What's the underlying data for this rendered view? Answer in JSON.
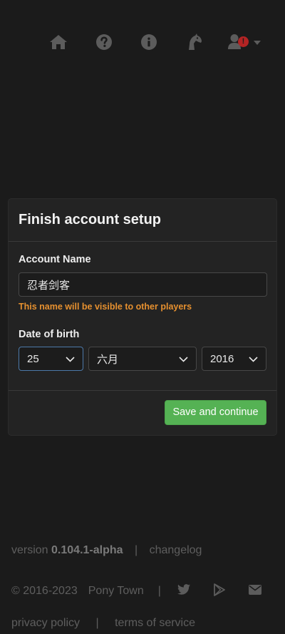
{
  "nav": {
    "icons": [
      "home-icon",
      "help-icon",
      "info-icon",
      "horse-icon",
      "account-icon"
    ],
    "account_alert": "!"
  },
  "card": {
    "title": "Finish account setup",
    "account_name_label": "Account Name",
    "account_name_value": "忍者剑客",
    "hint": "This name will be visible to other players",
    "dob_label": "Date of birth",
    "day": "25",
    "month": "六月",
    "year": "2016",
    "submit": "Save and continue"
  },
  "footer": {
    "version_prefix": "version",
    "version": "0.104.1-alpha",
    "sep": "|",
    "changelog": "changelog",
    "copyright": "© 2016-2023",
    "site": "Pony Town",
    "privacy": "privacy policy",
    "terms": "terms of service"
  },
  "colors": {
    "background": "#1b1b1b",
    "card": "#232323",
    "accent_green": "#55b254",
    "hint_orange": "#e6902f",
    "focus_blue": "#4c79a9",
    "alert_red": "#b32424"
  }
}
